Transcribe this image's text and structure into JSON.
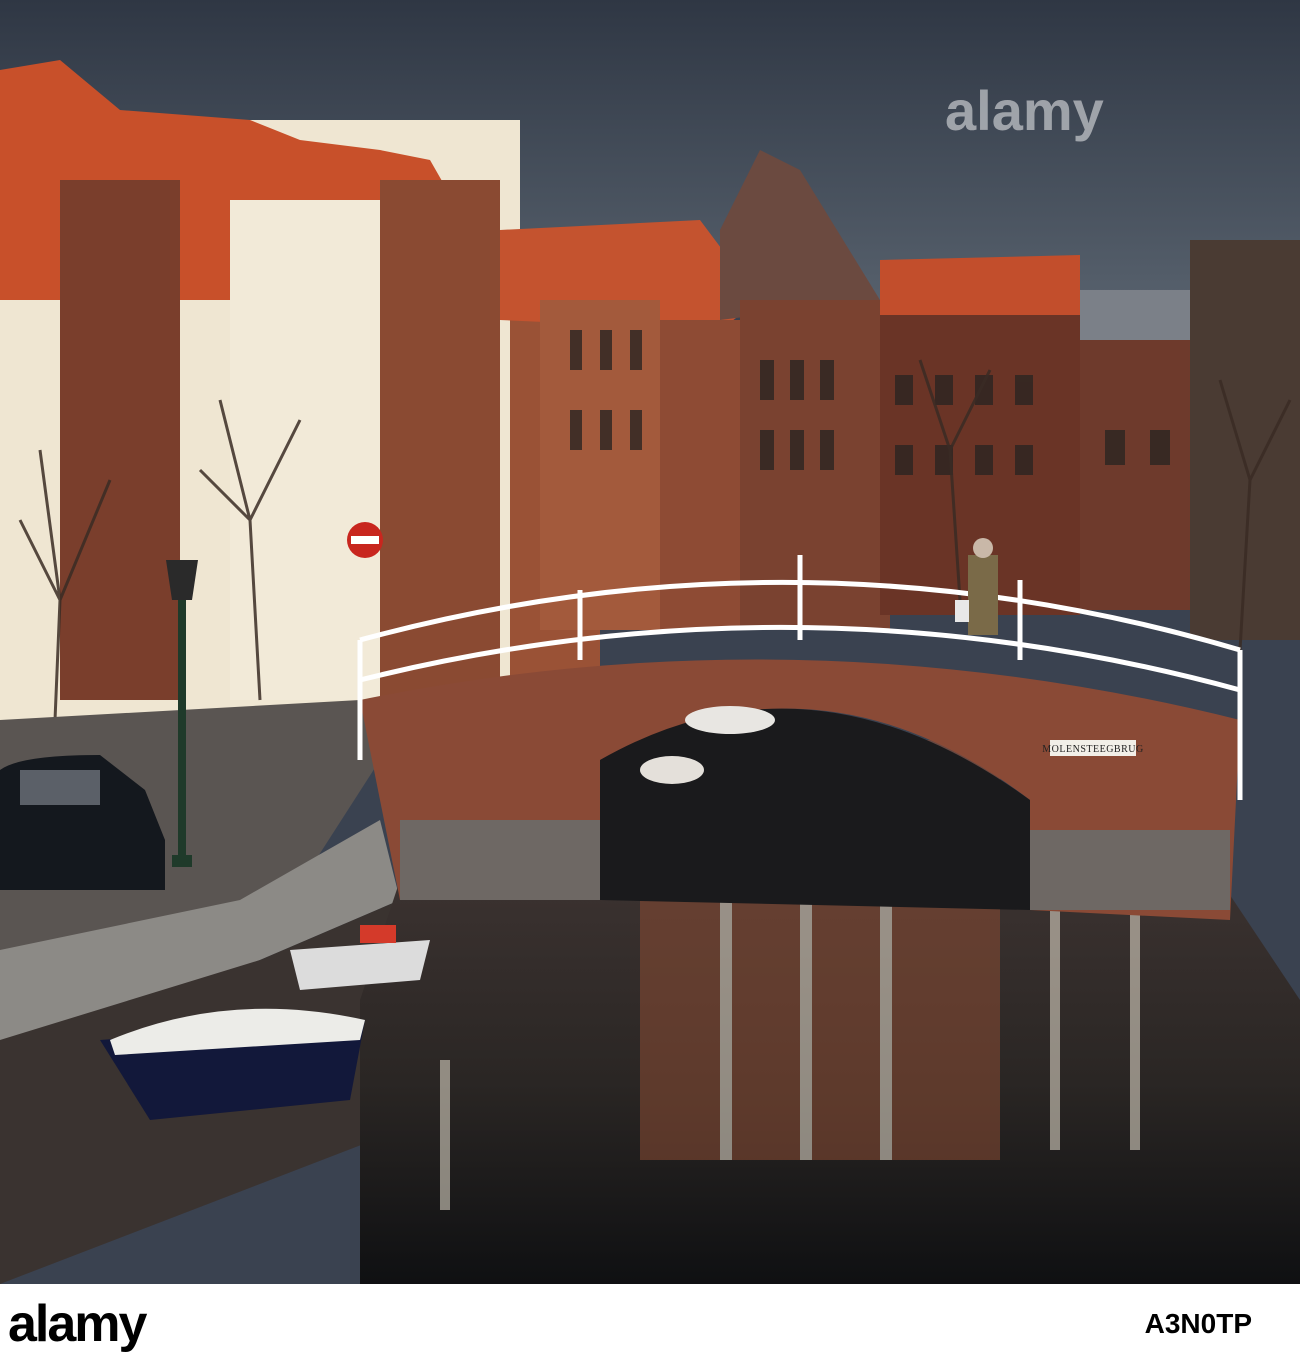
{
  "photo": {
    "description_tag": "canal-street-bridge-photo",
    "sign_text": "MOLENSTEEGBRUG"
  },
  "watermark": {
    "text": "alamy"
  },
  "footer": {
    "logo_text": "alamy",
    "image_id": "A3N0TP"
  },
  "colors": {
    "sky": "#3b4452",
    "roof": "#c8502a",
    "brick": "#7a3e2c",
    "water": "#23252a",
    "boat": "#12183a"
  }
}
